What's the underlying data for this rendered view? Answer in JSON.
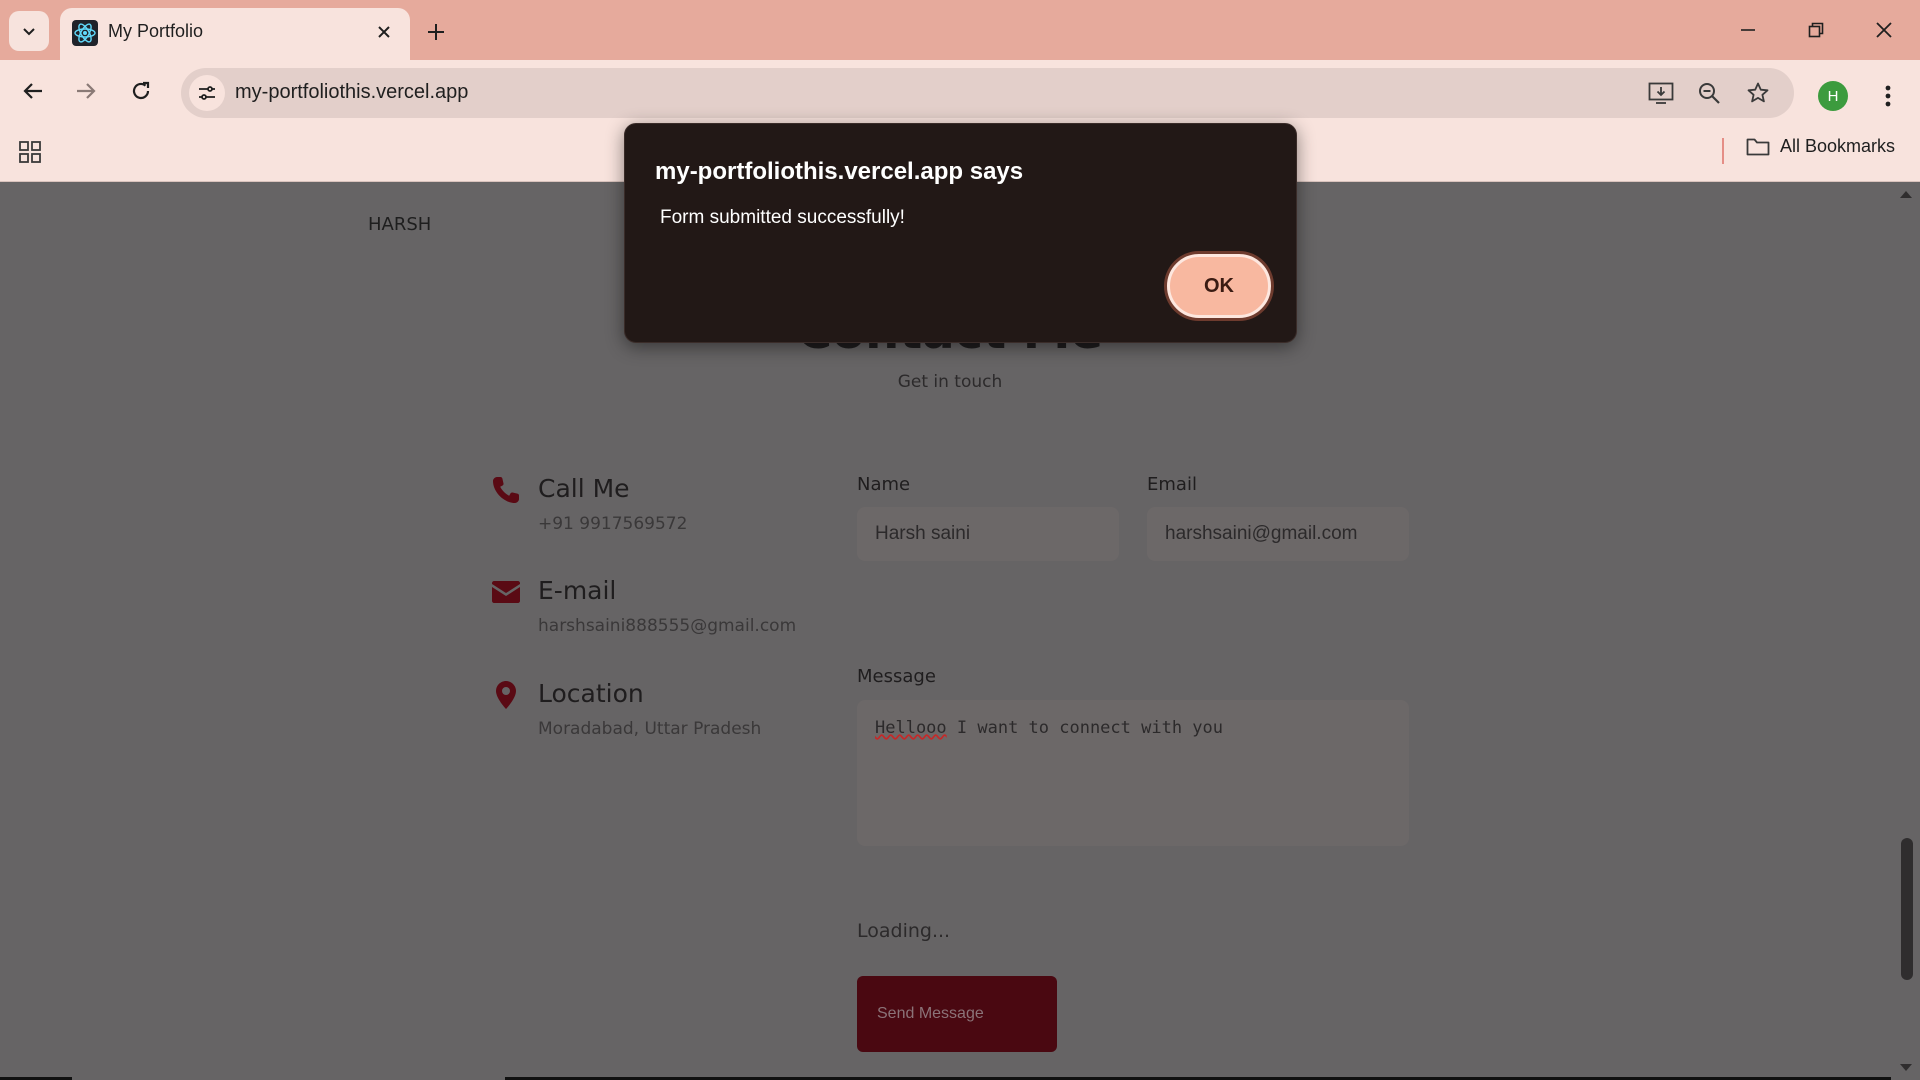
{
  "browser": {
    "tab_title": "My Portfolio",
    "url": "my-portfoliothis.vercel.app",
    "profile_initial": "H",
    "all_bookmarks_label": "All Bookmarks"
  },
  "page": {
    "brand": "HARSH",
    "section_title": "Contact Me",
    "section_subtitle": "Get in touch",
    "contact_info": [
      {
        "label": "Call Me",
        "value": "+91 9917569572",
        "icon": "phone-icon"
      },
      {
        "label": "E-mail",
        "value": "harshsaini888555@gmail.com",
        "icon": "envelope-icon"
      },
      {
        "label": "Location",
        "value": "Moradabad, Uttar Pradesh",
        "icon": "map-pin-icon"
      }
    ],
    "form": {
      "name_label": "Name",
      "name_value": "Harsh saini",
      "email_label": "Email",
      "email_value": "harshsaini@gmail.com",
      "message_label": "Message",
      "message_first_word": "Hellooo",
      "message_rest": " I want to connect with you",
      "status": "Loading...",
      "submit_label": "Send Message"
    }
  },
  "dialog": {
    "title": "my-portfoliothis.vercel.app says",
    "message": "Form submitted successfully!",
    "ok_label": "OK"
  },
  "colors": {
    "accent": "#4a0811",
    "icon_color": "#5a0a14",
    "chrome": "#f8e3dd",
    "tabstrip": "#e6aa9c"
  }
}
